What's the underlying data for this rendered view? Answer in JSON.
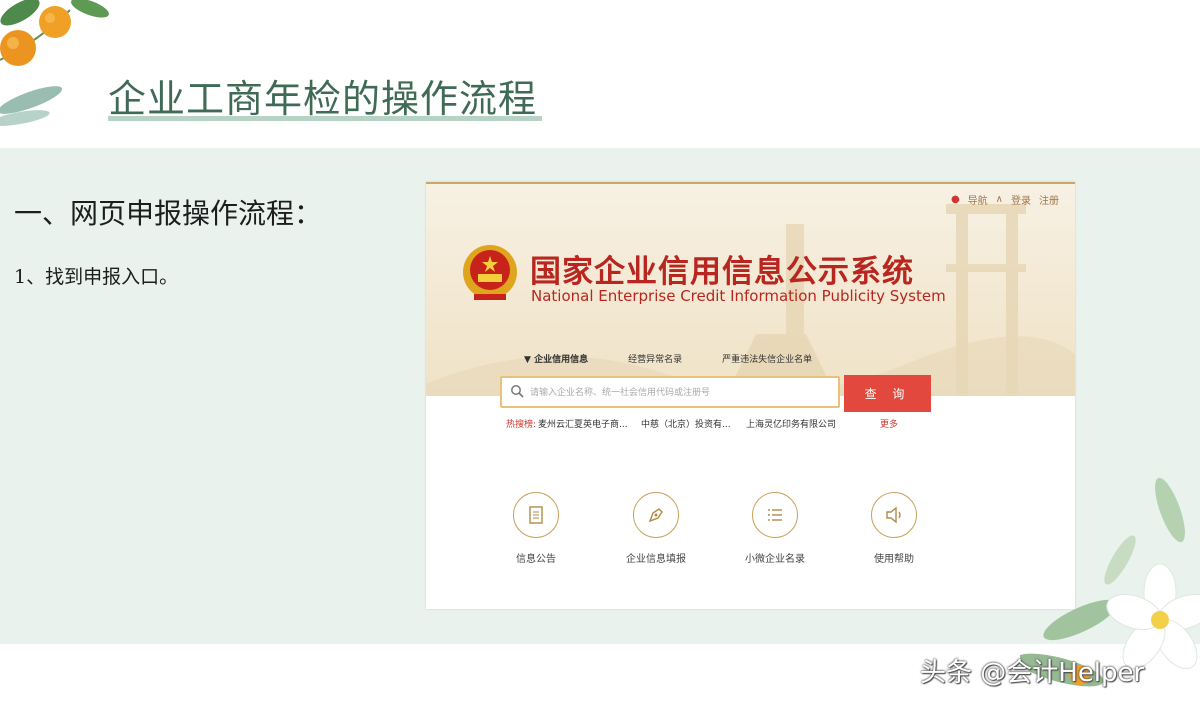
{
  "slide": {
    "title": "企业工商年检的操作流程",
    "section_heading": "一、网页申报操作流程：",
    "step_1": "1、找到申报入口。"
  },
  "website": {
    "nav": {
      "guide": "导航",
      "login": "登录",
      "register": "注册"
    },
    "title_cn": "国家企业信用信息公示系统",
    "title_en": "National Enterprise Credit Information Publicity System",
    "search_tabs": [
      "企业信用信息",
      "经营异常名录",
      "严重违法失信企业名单"
    ],
    "search": {
      "placeholder": "请输入企业名称、统一社会信用代码或注册号",
      "button": "查 询"
    },
    "hot": {
      "label": "热搜榜:",
      "items": [
        "麦州云汇夏英电子商...",
        "中慈（北京）投资有...",
        "上海灵亿印务有限公司"
      ],
      "more": "更多"
    },
    "features": [
      {
        "label": "信息公告",
        "icon": "document-icon"
      },
      {
        "label": "企业信息填报",
        "icon": "pen-icon"
      },
      {
        "label": "小微企业名录",
        "icon": "list-icon"
      },
      {
        "label": "使用帮助",
        "icon": "speaker-icon"
      }
    ]
  },
  "watermark": "头条 @会计Helper",
  "colors": {
    "title_green": "#3f6b56",
    "band_green": "#eaf2ee",
    "site_red": "#b8261f",
    "button_red": "#e2483d",
    "gold": "#caa25e"
  }
}
